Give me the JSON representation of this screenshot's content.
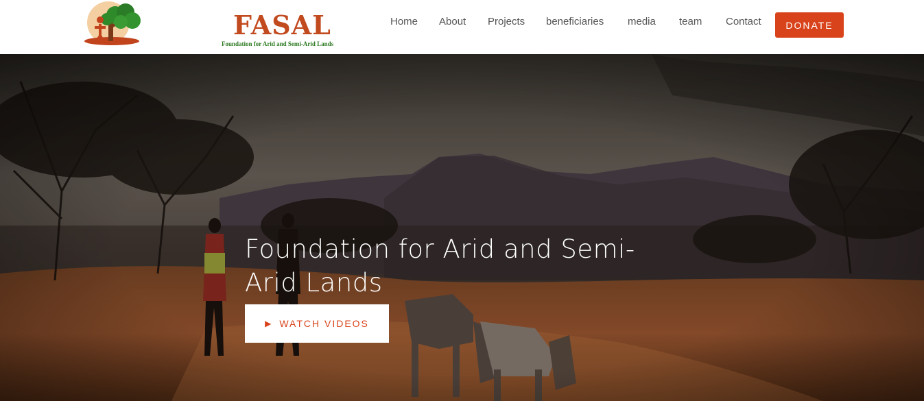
{
  "logo": {
    "name": "FASAL",
    "tagline": "Foundation for Arid and Semi-Arid Lands"
  },
  "nav": {
    "items": [
      {
        "label": "Home"
      },
      {
        "label": "About"
      },
      {
        "label": "Projects"
      },
      {
        "label": "beneficiaries"
      },
      {
        "label": "media"
      },
      {
        "label": "team"
      },
      {
        "label": "Contact"
      }
    ],
    "donate_label": "DONATE"
  },
  "hero": {
    "title": "Foundation for Arid and Semi-Arid Lands",
    "button_icon": "play-icon",
    "button_label": "WATCH VIDEOS"
  },
  "colors": {
    "accent": "#d9431b",
    "logo_text": "#c24a1f",
    "logo_green": "#2d7a22",
    "nav_text": "#555555"
  }
}
